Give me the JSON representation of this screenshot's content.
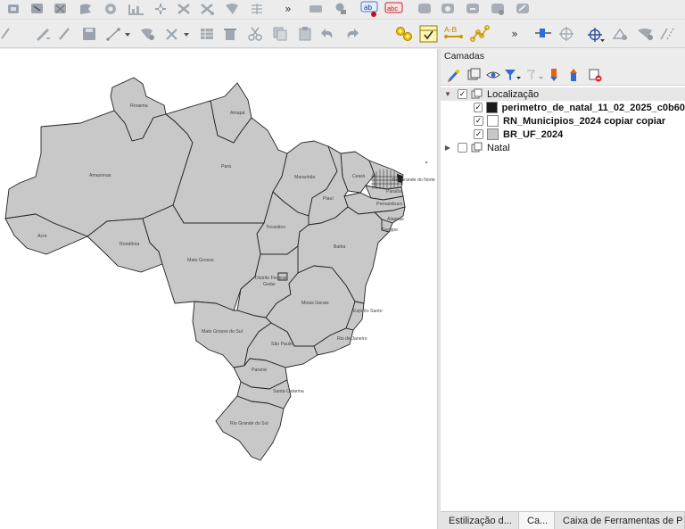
{
  "toolbar_top": {
    "overflow_label": "»",
    "label_tool_text": "ab",
    "label_tool_text2": "abc"
  },
  "toolbar_second": {
    "overflow_label": "»",
    "distance_label": "A-B"
  },
  "map": {
    "states": [
      {
        "id": "roraima",
        "label": "Roraima"
      },
      {
        "id": "amapa",
        "label": "Amapá"
      },
      {
        "id": "amazonas",
        "label": "Amazonas"
      },
      {
        "id": "para",
        "label": "Pará"
      },
      {
        "id": "maranhao",
        "label": "Maranhão"
      },
      {
        "id": "ceara",
        "label": "Ceará"
      },
      {
        "id": "rn",
        "label": "Rio Grande do Norte"
      },
      {
        "id": "paraiba",
        "label": "Paraíba"
      },
      {
        "id": "pernambuco",
        "label": "Pernambuco"
      },
      {
        "id": "piaui",
        "label": "Piauí"
      },
      {
        "id": "alagoas",
        "label": "Alagoas"
      },
      {
        "id": "sergipe",
        "label": "Sergipe"
      },
      {
        "id": "acre",
        "label": "Acre"
      },
      {
        "id": "tocantins",
        "label": "Tocantins"
      },
      {
        "id": "rondonia",
        "label": "Rondônia"
      },
      {
        "id": "bahia",
        "label": "Bahia"
      },
      {
        "id": "mato_grosso",
        "label": "Mato Grosso"
      },
      {
        "id": "df",
        "label": "Distrito Federal"
      },
      {
        "id": "goias",
        "label": "Goiás"
      },
      {
        "id": "minas",
        "label": "Minas Gerais"
      },
      {
        "id": "es",
        "label": "Espírito Santo"
      },
      {
        "id": "ms",
        "label": "Mato Grosso do Sul"
      },
      {
        "id": "sp",
        "label": "São Paulo"
      },
      {
        "id": "rj",
        "label": "Rio de Janeiro"
      },
      {
        "id": "parana",
        "label": "Paraná"
      },
      {
        "id": "sc",
        "label": "Santa Catarina"
      },
      {
        "id": "rs",
        "label": "Rio Grande do Sul"
      }
    ],
    "fill_color": "#c8c8c8",
    "stroke_color": "#232323"
  },
  "layers_panel": {
    "title": "Camadas",
    "groups": [
      {
        "name": "Localização",
        "expanded": true,
        "checked": true,
        "layers": [
          {
            "name": "perimetro_de_natal_11_02_2025_c0b60",
            "checked": true,
            "swatch": "#1a1a1a"
          },
          {
            "name": "RN_Municipios_2024  copiar  copiar",
            "checked": true,
            "swatch": "#ffffff"
          },
          {
            "name": "BR_UF_2024",
            "checked": true,
            "swatch": "#c8c8c8"
          }
        ]
      },
      {
        "name": "Natal",
        "expanded": false,
        "checked": false,
        "layers": []
      }
    ],
    "check_mark": "✓",
    "expand_arrow": "▼",
    "collapse_arrow": "▶"
  },
  "bottom_tabs": [
    {
      "label": "Estilização d..."
    },
    {
      "label": "Ca..."
    },
    {
      "label": "Caixa de Ferramentas de P"
    }
  ]
}
